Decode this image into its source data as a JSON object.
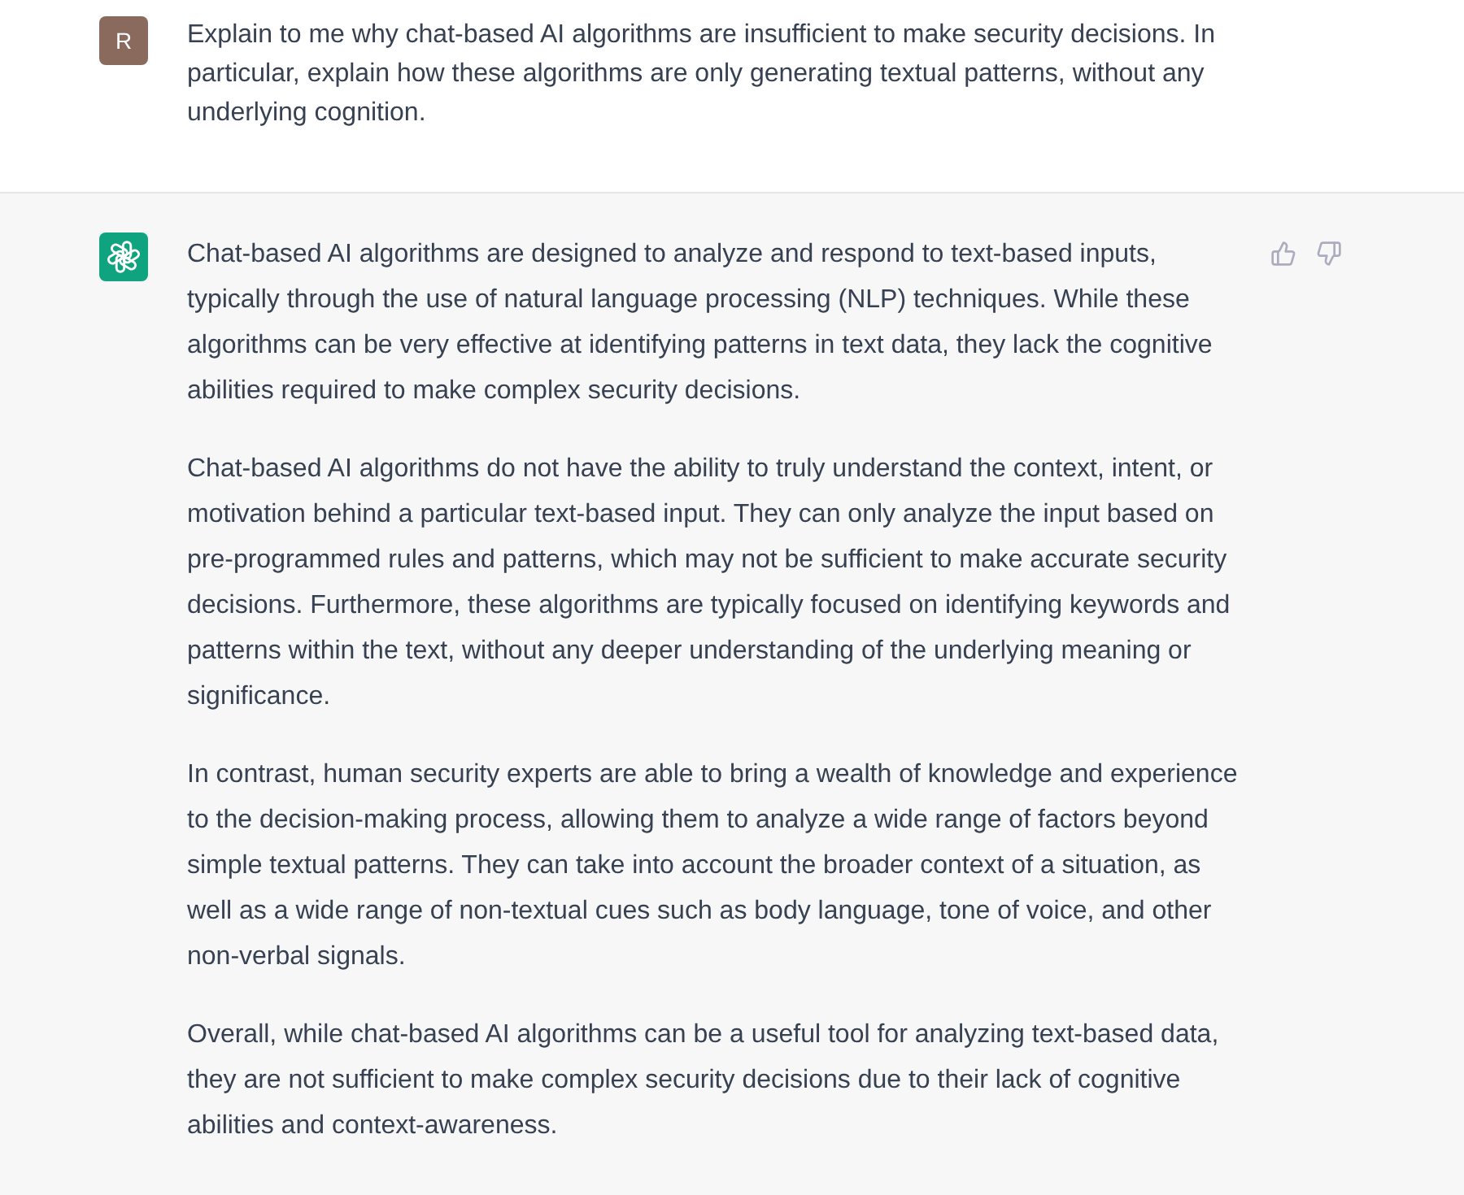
{
  "messages": [
    {
      "kind": "user",
      "avatar_letter": "R",
      "paragraphs": [
        "Explain to me why chat-based AI algorithms are insufficient to make security decisions. In particular, explain how these algorithms are only generating textual patterns, without any underlying cognition."
      ]
    },
    {
      "kind": "assistant",
      "paragraphs": [
        "Chat-based AI algorithms are designed to analyze and respond to text-based inputs, typically through the use of natural language processing (NLP) techniques. While these algorithms can be very effective at identifying patterns in text data, they lack the cognitive abilities required to make complex security decisions.",
        "Chat-based AI algorithms do not have the ability to truly understand the context, intent, or motivation behind a particular text-based input. They can only analyze the input based on pre-programmed rules and patterns, which may not be sufficient to make accurate security decisions. Furthermore, these algorithms are typically focused on identifying keywords and patterns within the text, without any deeper understanding of the underlying meaning or significance.",
        "In contrast, human security experts are able to bring a wealth of knowledge and experience to the decision-making process, allowing them to analyze a wide range of factors beyond simple textual patterns. They can take into account the broader context of a situation, as well as a wide range of non-textual cues such as body language, tone of voice, and other non-verbal signals.",
        "Overall, while chat-based AI algorithms can be a useful tool for analyzing text-based data, they are not sufficient to make complex security decisions due to their lack of cognitive abilities and context-awareness."
      ]
    }
  ]
}
